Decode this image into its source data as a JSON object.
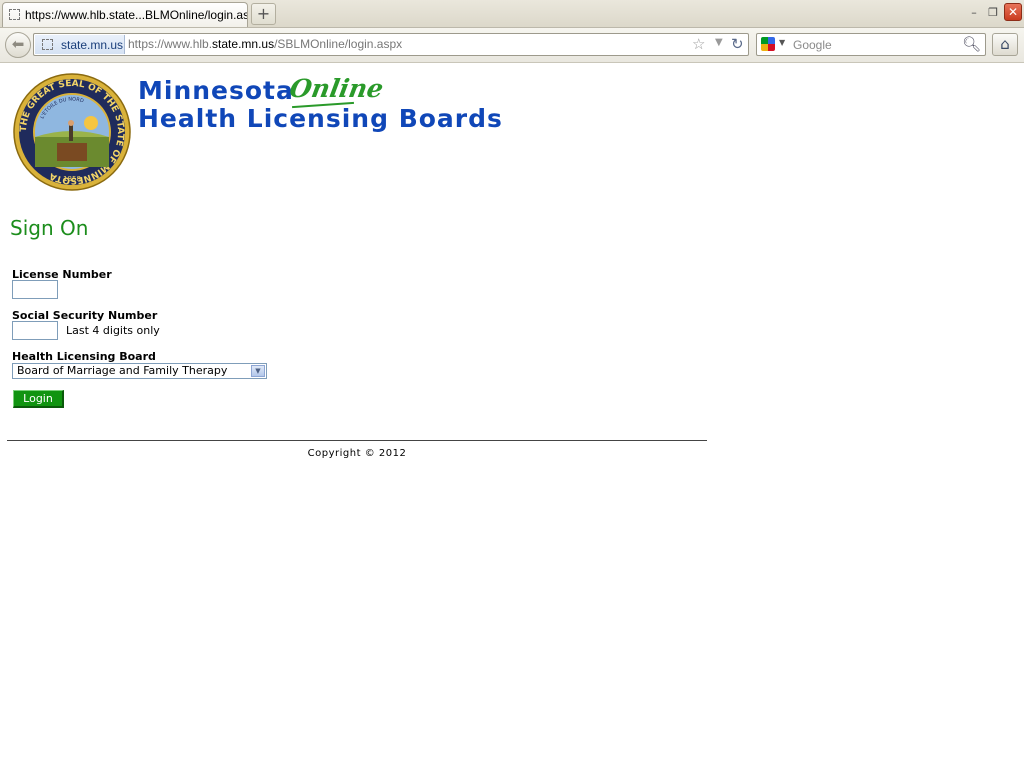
{
  "browser": {
    "tab_title": "https://www.hlb.state...BLMOnline/login.aspx",
    "new_tab_symbol": "+",
    "window_controls": {
      "minimize": "–",
      "restore": "❐",
      "close": "✕"
    },
    "site_identity": "state.mn.us",
    "url": {
      "prefix": "https://www.hlb.",
      "host": "state.mn.us",
      "path": "/SBLMOnline/login.aspx"
    },
    "search_placeholder": "Google",
    "icons": {
      "back": "back-arrow-icon",
      "star": "star-icon",
      "reload": "reload-icon",
      "search_go": "magnifier-icon",
      "home": "home-icon"
    }
  },
  "header": {
    "brand_line1": "Minnesota",
    "brand_online": "Online",
    "brand_line2": "Health Licensing Boards",
    "seal": {
      "outer_text": "THE GREAT SEAL OF THE STATE OF MINNESOTA",
      "motto": "L'ETOILE DU NORD",
      "year": "1858"
    },
    "colors": {
      "brand_blue": "#1047b8",
      "online_green": "#2a9a2a"
    }
  },
  "form": {
    "title": "Sign On",
    "license_label": "License Number",
    "license_value": "",
    "ssn_label": "Social Security Number",
    "ssn_value": "",
    "ssn_hint": "Last 4 digits only",
    "board_label": "Health Licensing Board",
    "board_selected": "Board of Marriage and Family Therapy",
    "login_label": "Login",
    "colors": {
      "title_green": "#1c8d1c",
      "button_green": "#109410"
    }
  },
  "footer": {
    "copyright": "Copyright © 2012"
  }
}
